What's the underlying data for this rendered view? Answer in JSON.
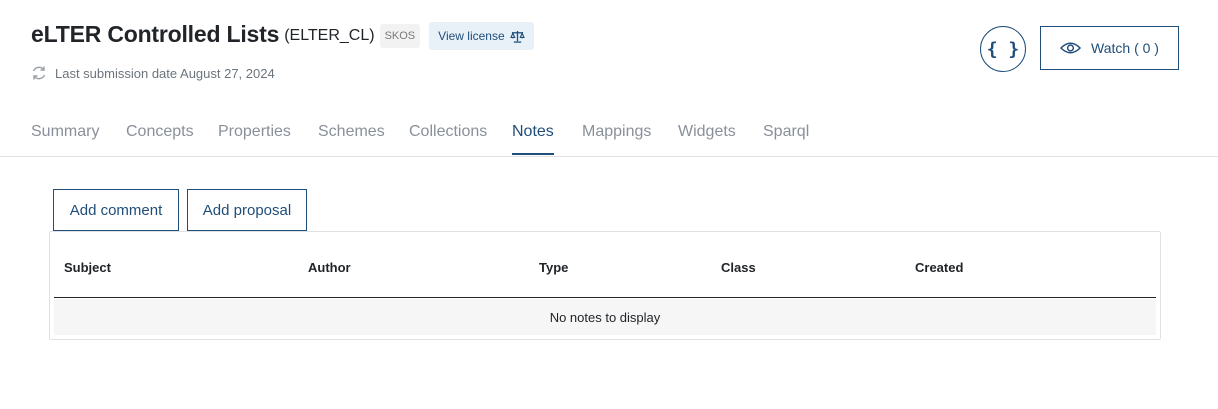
{
  "header": {
    "title": "eLTER Controlled Lists",
    "acronym": "(ELTER_CL)",
    "format_badge": "SKOS",
    "license_label": "View license",
    "license_icon": "scale-icon",
    "submission_icon": "refresh-icon",
    "submission_text": "Last submission date August 27, 2024",
    "json_button_label": "{ }",
    "watch_label": "Watch ( 0 )",
    "watch_icon": "eye-icon"
  },
  "tabs": [
    {
      "label": "Summary",
      "active": false
    },
    {
      "label": "Concepts",
      "active": false
    },
    {
      "label": "Properties",
      "active": false
    },
    {
      "label": "Schemes",
      "active": false
    },
    {
      "label": "Collections",
      "active": false
    },
    {
      "label": "Notes",
      "active": true
    },
    {
      "label": "Mappings",
      "active": false
    },
    {
      "label": "Widgets",
      "active": false
    },
    {
      "label": "Sparql",
      "active": false
    }
  ],
  "notes": {
    "add_comment_label": "Add comment",
    "add_proposal_label": "Add proposal",
    "columns": [
      "Subject",
      "Author",
      "Type",
      "Class",
      "Created"
    ],
    "empty_text": "No notes to display"
  },
  "colors": {
    "accent": "#1f4e79",
    "muted_text": "#8a9099",
    "badge_bg": "#f2f2f2",
    "license_bg": "#e9f1f8"
  }
}
